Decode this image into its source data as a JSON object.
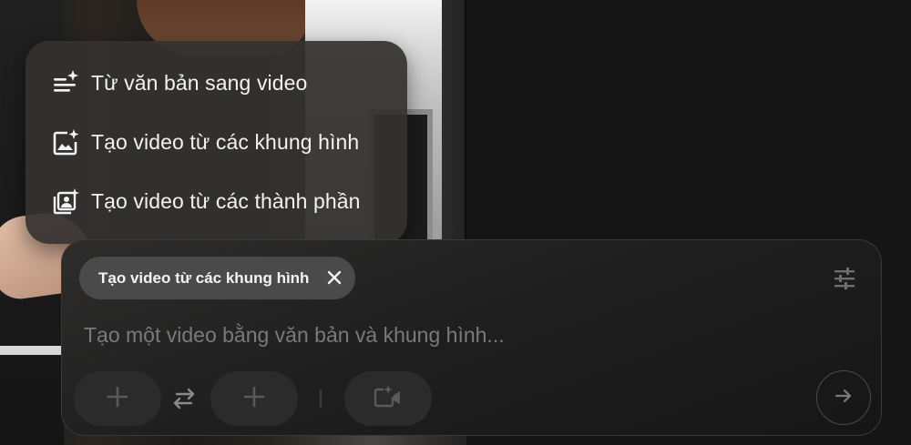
{
  "menu": {
    "items": [
      {
        "label": "Từ văn bản sang video",
        "icon": "text-sparkle-icon"
      },
      {
        "label": "Tạo video từ các khung hình",
        "icon": "image-sparkle-icon"
      },
      {
        "label": "Tạo video từ các thành phần",
        "icon": "ingredients-sparkle-icon"
      }
    ]
  },
  "composer": {
    "mode_chip_label": "Tạo video từ các khung hình",
    "prompt_placeholder": "Tạo một video bằng văn bản và khung hình...",
    "prompt_value": ""
  },
  "colors": {
    "menu_bg": "#343230",
    "chip_bg": "#4a4a4a",
    "card_bg": "#1f1f1f",
    "text": "#f2f2f2",
    "placeholder": "#7a7a7a"
  }
}
